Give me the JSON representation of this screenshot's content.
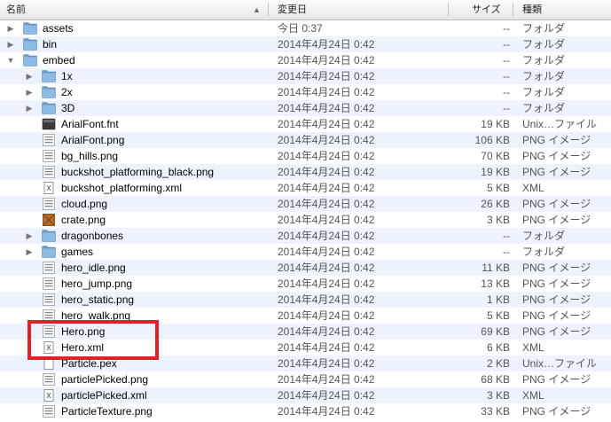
{
  "header": {
    "name": "名前",
    "date": "変更日",
    "size": "サイズ",
    "kind": "種類",
    "sort_arrow": "▲"
  },
  "rows": [
    {
      "name": "assets",
      "date": "今日 0:37",
      "size": "--",
      "kind": "フォルダ",
      "icon": "folder-icon",
      "disclosure": "collapsed",
      "level": 0
    },
    {
      "name": "bin",
      "date": "2014年4月24日 0:42",
      "size": "--",
      "kind": "フォルダ",
      "icon": "folder-icon",
      "disclosure": "collapsed",
      "level": 0
    },
    {
      "name": "embed",
      "date": "2014年4月24日 0:42",
      "size": "--",
      "kind": "フォルダ",
      "icon": "folder-icon",
      "disclosure": "expanded",
      "level": 0
    },
    {
      "name": "1x",
      "date": "2014年4月24日 0:42",
      "size": "--",
      "kind": "フォルダ",
      "icon": "folder-icon",
      "disclosure": "collapsed",
      "level": 1
    },
    {
      "name": "2x",
      "date": "2014年4月24日 0:42",
      "size": "--",
      "kind": "フォルダ",
      "icon": "folder-icon",
      "disclosure": "collapsed",
      "level": 1
    },
    {
      "name": "3D",
      "date": "2014年4月24日 0:42",
      "size": "--",
      "kind": "フォルダ",
      "icon": "folder-icon",
      "disclosure": "collapsed",
      "level": 1
    },
    {
      "name": "ArialFont.fnt",
      "date": "2014年4月24日 0:42",
      "size": "19 KB",
      "kind": "Unix…ファイル",
      "icon": "unix-executable-icon",
      "disclosure": "none",
      "level": 1
    },
    {
      "name": "ArialFont.png",
      "date": "2014年4月24日 0:42",
      "size": "106 KB",
      "kind": "PNG イメージ",
      "icon": "png-file-icon",
      "disclosure": "none",
      "level": 1
    },
    {
      "name": "bg_hills.png",
      "date": "2014年4月24日 0:42",
      "size": "70 KB",
      "kind": "PNG イメージ",
      "icon": "png-file-icon",
      "disclosure": "none",
      "level": 1
    },
    {
      "name": "buckshot_platforming_black.png",
      "date": "2014年4月24日 0:42",
      "size": "19 KB",
      "kind": "PNG イメージ",
      "icon": "png-file-icon",
      "disclosure": "none",
      "level": 1
    },
    {
      "name": "buckshot_platforming.xml",
      "date": "2014年4月24日 0:42",
      "size": "5 KB",
      "kind": "XML",
      "icon": "xml-file-icon",
      "disclosure": "none",
      "level": 1
    },
    {
      "name": "cloud.png",
      "date": "2014年4月24日 0:42",
      "size": "26 KB",
      "kind": "PNG イメージ",
      "icon": "png-file-icon",
      "disclosure": "none",
      "level": 1
    },
    {
      "name": "crate.png",
      "date": "2014年4月24日 0:42",
      "size": "3 KB",
      "kind": "PNG イメージ",
      "icon": "crate-image-icon",
      "disclosure": "none",
      "level": 1
    },
    {
      "name": "dragonbones",
      "date": "2014年4月24日 0:42",
      "size": "--",
      "kind": "フォルダ",
      "icon": "folder-icon",
      "disclosure": "collapsed",
      "level": 1
    },
    {
      "name": "games",
      "date": "2014年4月24日 0:42",
      "size": "--",
      "kind": "フォルダ",
      "icon": "folder-icon",
      "disclosure": "collapsed",
      "level": 1
    },
    {
      "name": "hero_idle.png",
      "date": "2014年4月24日 0:42",
      "size": "11 KB",
      "kind": "PNG イメージ",
      "icon": "png-file-icon",
      "disclosure": "none",
      "level": 1
    },
    {
      "name": "hero_jump.png",
      "date": "2014年4月24日 0:42",
      "size": "13 KB",
      "kind": "PNG イメージ",
      "icon": "png-file-icon",
      "disclosure": "none",
      "level": 1
    },
    {
      "name": "hero_static.png",
      "date": "2014年4月24日 0:42",
      "size": "1 KB",
      "kind": "PNG イメージ",
      "icon": "png-file-icon",
      "disclosure": "none",
      "level": 1
    },
    {
      "name": "hero_walk.png",
      "date": "2014年4月24日 0:42",
      "size": "5 KB",
      "kind": "PNG イメージ",
      "icon": "png-file-icon",
      "disclosure": "none",
      "level": 1
    },
    {
      "name": "Hero.png",
      "date": "2014年4月24日 0:42",
      "size": "69 KB",
      "kind": "PNG イメージ",
      "icon": "png-file-icon",
      "disclosure": "none",
      "level": 1
    },
    {
      "name": "Hero.xml",
      "date": "2014年4月24日 0:42",
      "size": "6 KB",
      "kind": "XML",
      "icon": "xml-file-icon",
      "disclosure": "none",
      "level": 1
    },
    {
      "name": "Particle.pex",
      "date": "2014年4月24日 0:42",
      "size": "2 KB",
      "kind": "Unix…ファイル",
      "icon": "document-icon",
      "disclosure": "none",
      "level": 1
    },
    {
      "name": "particlePicked.png",
      "date": "2014年4月24日 0:42",
      "size": "68 KB",
      "kind": "PNG イメージ",
      "icon": "png-file-icon",
      "disclosure": "none",
      "level": 1
    },
    {
      "name": "particlePicked.xml",
      "date": "2014年4月24日 0:42",
      "size": "3 KB",
      "kind": "XML",
      "icon": "xml-file-icon",
      "disclosure": "none",
      "level": 1
    },
    {
      "name": "ParticleTexture.png",
      "date": "2014年4月24日 0:42",
      "size": "33 KB",
      "kind": "PNG イメージ",
      "icon": "png-file-icon",
      "disclosure": "none",
      "level": 1
    }
  ],
  "colors": {
    "stripe": "#edf3fe",
    "highlight_box": "#e0202a",
    "folder": "#7fb0dc"
  }
}
